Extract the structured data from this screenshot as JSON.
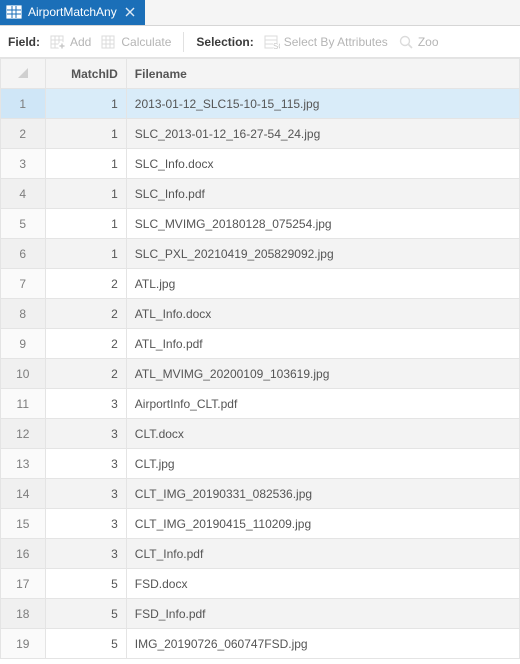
{
  "tab": {
    "title": "AirportMatchAny"
  },
  "toolbar": {
    "field_label": "Field:",
    "add_label": "Add",
    "calculate_label": "Calculate",
    "selection_label": "Selection:",
    "select_by_attr_label": "Select By Attributes",
    "zoom_label": "Zoo"
  },
  "table": {
    "columns": {
      "matchid": "MatchID",
      "filename": "Filename"
    },
    "selected_row_index": 0,
    "rows": [
      {
        "n": 1,
        "matchid": 1,
        "filename": "2013-01-12_SLC15-10-15_115.jpg"
      },
      {
        "n": 2,
        "matchid": 1,
        "filename": "SLC_2013-01-12_16-27-54_24.jpg"
      },
      {
        "n": 3,
        "matchid": 1,
        "filename": "SLC_Info.docx"
      },
      {
        "n": 4,
        "matchid": 1,
        "filename": "SLC_Info.pdf"
      },
      {
        "n": 5,
        "matchid": 1,
        "filename": "SLC_MVIMG_20180128_075254.jpg"
      },
      {
        "n": 6,
        "matchid": 1,
        "filename": "SLC_PXL_20210419_205829092.jpg"
      },
      {
        "n": 7,
        "matchid": 2,
        "filename": "ATL.jpg"
      },
      {
        "n": 8,
        "matchid": 2,
        "filename": "ATL_Info.docx"
      },
      {
        "n": 9,
        "matchid": 2,
        "filename": "ATL_Info.pdf"
      },
      {
        "n": 10,
        "matchid": 2,
        "filename": "ATL_MVIMG_20200109_103619.jpg"
      },
      {
        "n": 11,
        "matchid": 3,
        "filename": "AirportInfo_CLT.pdf"
      },
      {
        "n": 12,
        "matchid": 3,
        "filename": "CLT.docx"
      },
      {
        "n": 13,
        "matchid": 3,
        "filename": "CLT.jpg"
      },
      {
        "n": 14,
        "matchid": 3,
        "filename": "CLT_IMG_20190331_082536.jpg"
      },
      {
        "n": 15,
        "matchid": 3,
        "filename": "CLT_IMG_20190415_110209.jpg"
      },
      {
        "n": 16,
        "matchid": 3,
        "filename": "CLT_Info.pdf"
      },
      {
        "n": 17,
        "matchid": 5,
        "filename": "FSD.docx"
      },
      {
        "n": 18,
        "matchid": 5,
        "filename": "FSD_Info.pdf"
      },
      {
        "n": 19,
        "matchid": 5,
        "filename": "IMG_20190726_060747FSD.jpg"
      }
    ]
  }
}
